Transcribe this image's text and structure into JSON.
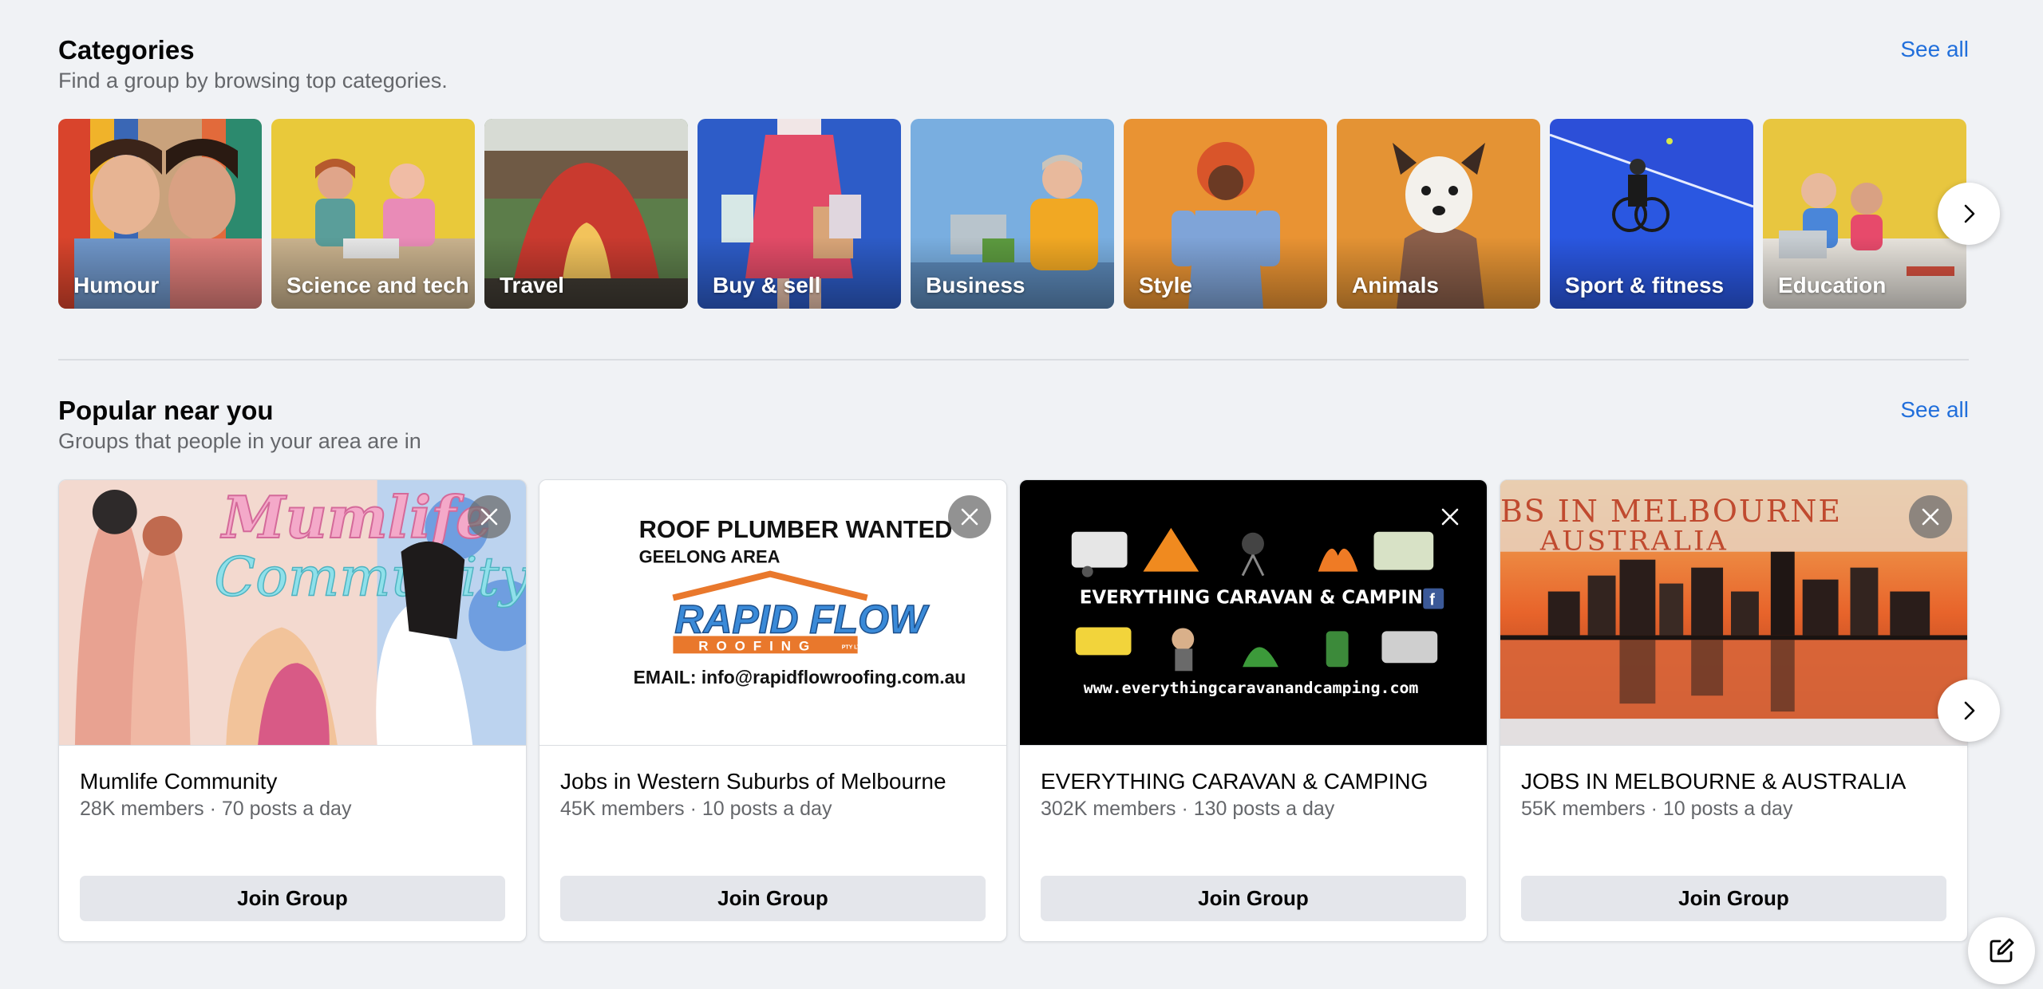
{
  "categories": {
    "title": "Categories",
    "subtitle": "Find a group by browsing top categories.",
    "see_all": "See all",
    "items": [
      {
        "label": "Humour",
        "icon": "humour-image"
      },
      {
        "label": "Science and tech",
        "icon": "science-tech-image"
      },
      {
        "label": "Travel",
        "icon": "travel-image"
      },
      {
        "label": "Buy & sell",
        "icon": "buy-sell-image"
      },
      {
        "label": "Business",
        "icon": "business-image"
      },
      {
        "label": "Style",
        "icon": "style-image"
      },
      {
        "label": "Animals",
        "icon": "animals-image"
      },
      {
        "label": "Sport & fitness",
        "icon": "sport-fitness-image"
      },
      {
        "label": "Education",
        "icon": "education-image"
      }
    ],
    "next_icon": "chevron-right-icon"
  },
  "popular": {
    "title": "Popular near you",
    "subtitle": "Groups that people in your area are in",
    "see_all": "See all",
    "groups": [
      {
        "name": "Mumlife Community",
        "members": "28K members",
        "posts": "70 posts a day",
        "join_label": "Join Group",
        "cover_text": [
          "Mumlife",
          "Community"
        ]
      },
      {
        "name": "Jobs in Western Suburbs of Melbourne",
        "members": "45K members",
        "posts": "10 posts a day",
        "join_label": "Join Group",
        "cover_text": [
          "ROOF PLUMBER WANTED",
          "GEELONG AREA",
          "RAPID FLOW",
          "ROOFING",
          "PTY LTD",
          "EMAIL: info@rapidflowroofing.com.au"
        ]
      },
      {
        "name": "EVERYTHING CARAVAN & CAMPING",
        "members": "302K members",
        "posts": "130 posts a day",
        "join_label": "Join Group",
        "cover_text": [
          "EVERYTHING CARAVAN & CAMPING",
          "f",
          "www.everythingcaravanandcamping.com"
        ]
      },
      {
        "name": "JOBS IN MELBOURNE & AUSTRALIA",
        "members": "55K members",
        "posts": "10 posts a day",
        "join_label": "Join Group",
        "cover_text": [
          "BS IN MELBOURNE",
          "AUSTRALIA"
        ]
      }
    ],
    "meta_separator": " · "
  },
  "colors": {
    "background": "#f0f2f5",
    "link": "#216fdb",
    "secondary_text": "#65676b",
    "button_bg": "#e4e6eb"
  }
}
